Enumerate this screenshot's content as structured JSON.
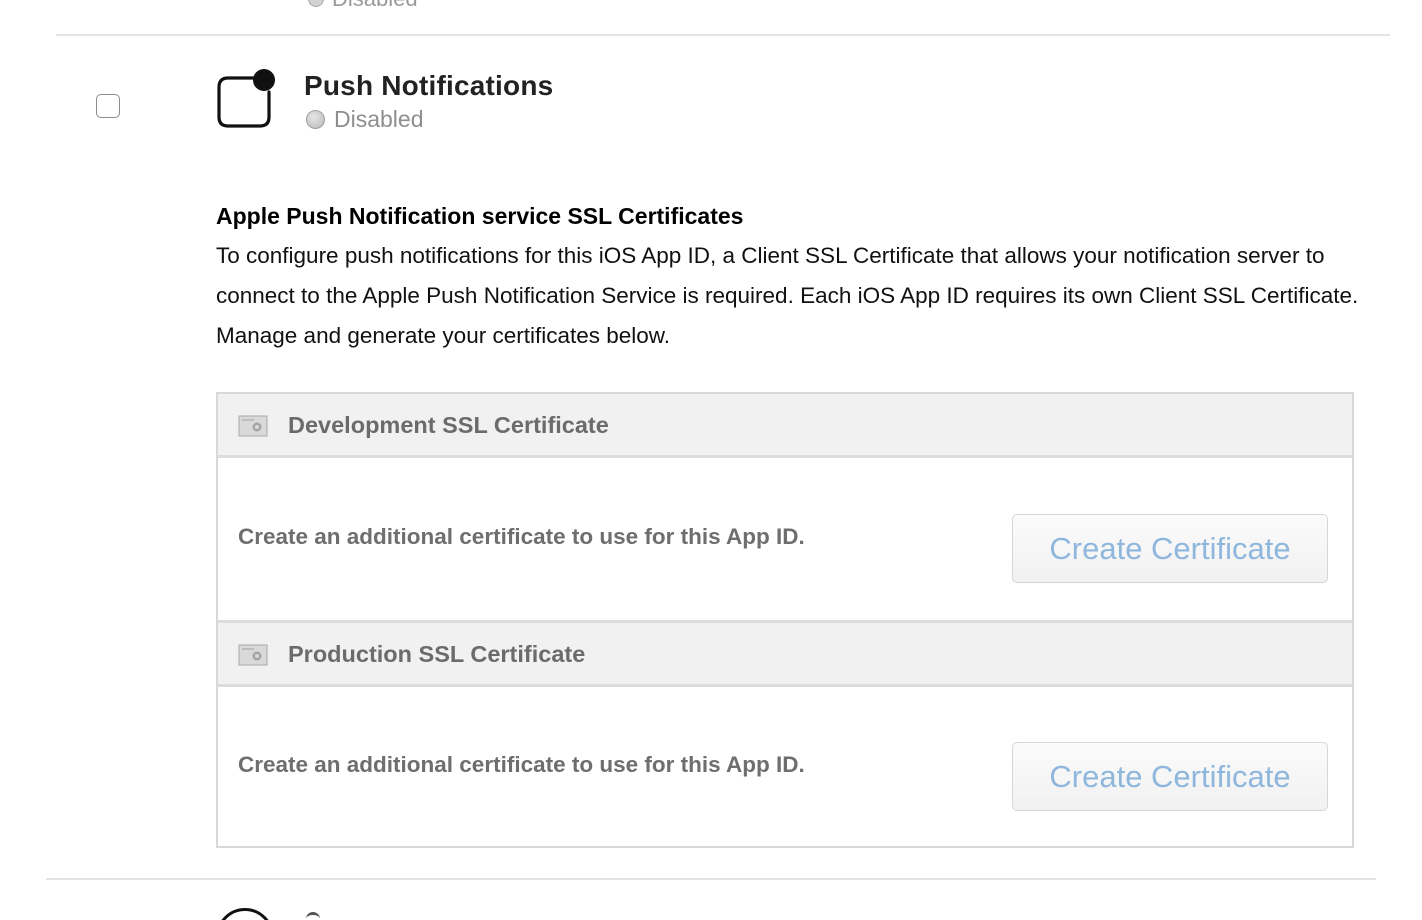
{
  "previous_row": {
    "status": "Disabled"
  },
  "service": {
    "title": "Push Notifications",
    "status": "Disabled",
    "icon": "push-notification-icon",
    "enabled": false
  },
  "apns": {
    "heading": "Apple Push Notification service SSL Certificates",
    "description": "To configure push notifications for this iOS App ID, a Client SSL Certificate that allows your notification server to connect to the Apple Push Notification Service is required. Each iOS App ID requires its own Client SSL Certificate. Manage and generate your certificates below."
  },
  "certificates": {
    "development": {
      "title": "Development SSL Certificate",
      "icon": "certificate-icon",
      "message": "Create an additional certificate to use for this App ID.",
      "button_label": "Create Certificate"
    },
    "production": {
      "title": "Production SSL Certificate",
      "icon": "certificate-icon",
      "message": "Create an additional certificate to use for this App ID.",
      "button_label": "Create Certificate"
    }
  },
  "colors": {
    "button_text": "#8fb7dd",
    "status_gray": "#8e8e8e",
    "panel_header_bg": "#f1f1f1"
  }
}
